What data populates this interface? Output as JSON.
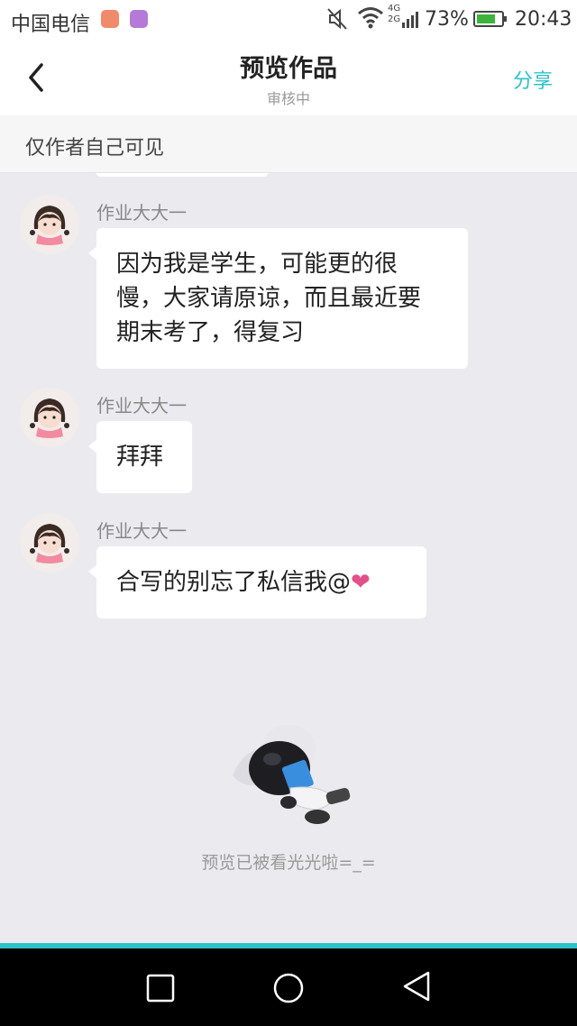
{
  "status_bar": {
    "carrier": "中国电信",
    "network": "4G\n2G",
    "battery_percent": "73%",
    "time": "20:43",
    "icons": [
      "app-notification-icon",
      "gallery-icon",
      "mute-icon",
      "wifi-icon",
      "signal-icon",
      "battery-icon"
    ]
  },
  "header": {
    "title": "预览作品",
    "subtitle": "审核中",
    "share_label": "分享",
    "back_icon": "back-arrow-icon"
  },
  "notice": {
    "text": "仅作者自己可见"
  },
  "messages": [
    {
      "sender": "作业大大一",
      "text": "因为我是学生，可能更的很慢，大家请原谅，而且最近要期末考了，得复习"
    },
    {
      "sender": "作业大大一",
      "text": "拜拜"
    },
    {
      "sender": "作业大大一",
      "text": "合写的别忘了私信我@",
      "emoji": "❤"
    }
  ],
  "empty_state": {
    "text": "预览已被看光光啦=_="
  },
  "colors": {
    "accent": "#2fc1c8",
    "heart": "#e0508a",
    "chat_bg": "#ebebef"
  }
}
